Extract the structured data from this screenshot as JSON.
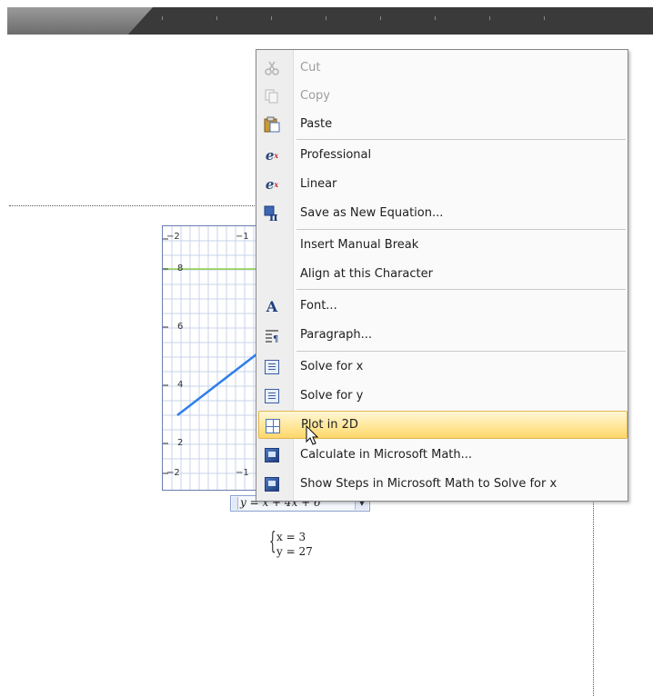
{
  "graph": {
    "x_labels_top": [
      "−2",
      "−1"
    ],
    "x_labels_bottom": [
      "−2",
      "−1"
    ],
    "y_labels": [
      "8",
      "6",
      "4",
      "2"
    ],
    "series_colors": {
      "horizontal_line": "#8ccf4a",
      "curve": "#2f7fe8"
    }
  },
  "equation": {
    "text": "y = x   + 4x + 6"
  },
  "solution": {
    "rows": [
      "x = 3",
      "y = 27"
    ]
  },
  "context_menu": {
    "highlight_color": "#ffe08a",
    "items": [
      {
        "label": "Cut",
        "icon": "scissors-icon",
        "enabled": false
      },
      {
        "label": "Copy",
        "icon": "copy-icon",
        "enabled": false
      },
      {
        "label": "Paste",
        "icon": "paste-icon",
        "enabled": true
      },
      {
        "label": "Professional",
        "icon": "professional-equation-icon",
        "enabled": true
      },
      {
        "label": "Linear",
        "icon": "linear-equation-icon",
        "enabled": true
      },
      {
        "label": "Save as New Equation...",
        "icon": "save-equation-icon",
        "enabled": true
      },
      {
        "label": "Insert Manual Break",
        "icon": "",
        "enabled": true
      },
      {
        "label": "Align at this Character",
        "icon": "",
        "enabled": true
      },
      {
        "label": "Font...",
        "icon": "font-icon",
        "enabled": true
      },
      {
        "label": "Paragraph...",
        "icon": "paragraph-icon",
        "enabled": true
      },
      {
        "label": "Solve for x",
        "icon": "solve-icon",
        "enabled": true
      },
      {
        "label": "Solve for y",
        "icon": "solve-icon",
        "enabled": true
      },
      {
        "label": "Plot in 2D",
        "icon": "plot-2d-icon",
        "enabled": true,
        "highlighted": true
      },
      {
        "label": "Calculate in Microsoft Math...",
        "icon": "microsoft-math-icon",
        "enabled": true
      },
      {
        "label": "Show Steps in Microsoft Math to Solve for x",
        "icon": "microsoft-math-icon",
        "enabled": true
      }
    ]
  }
}
